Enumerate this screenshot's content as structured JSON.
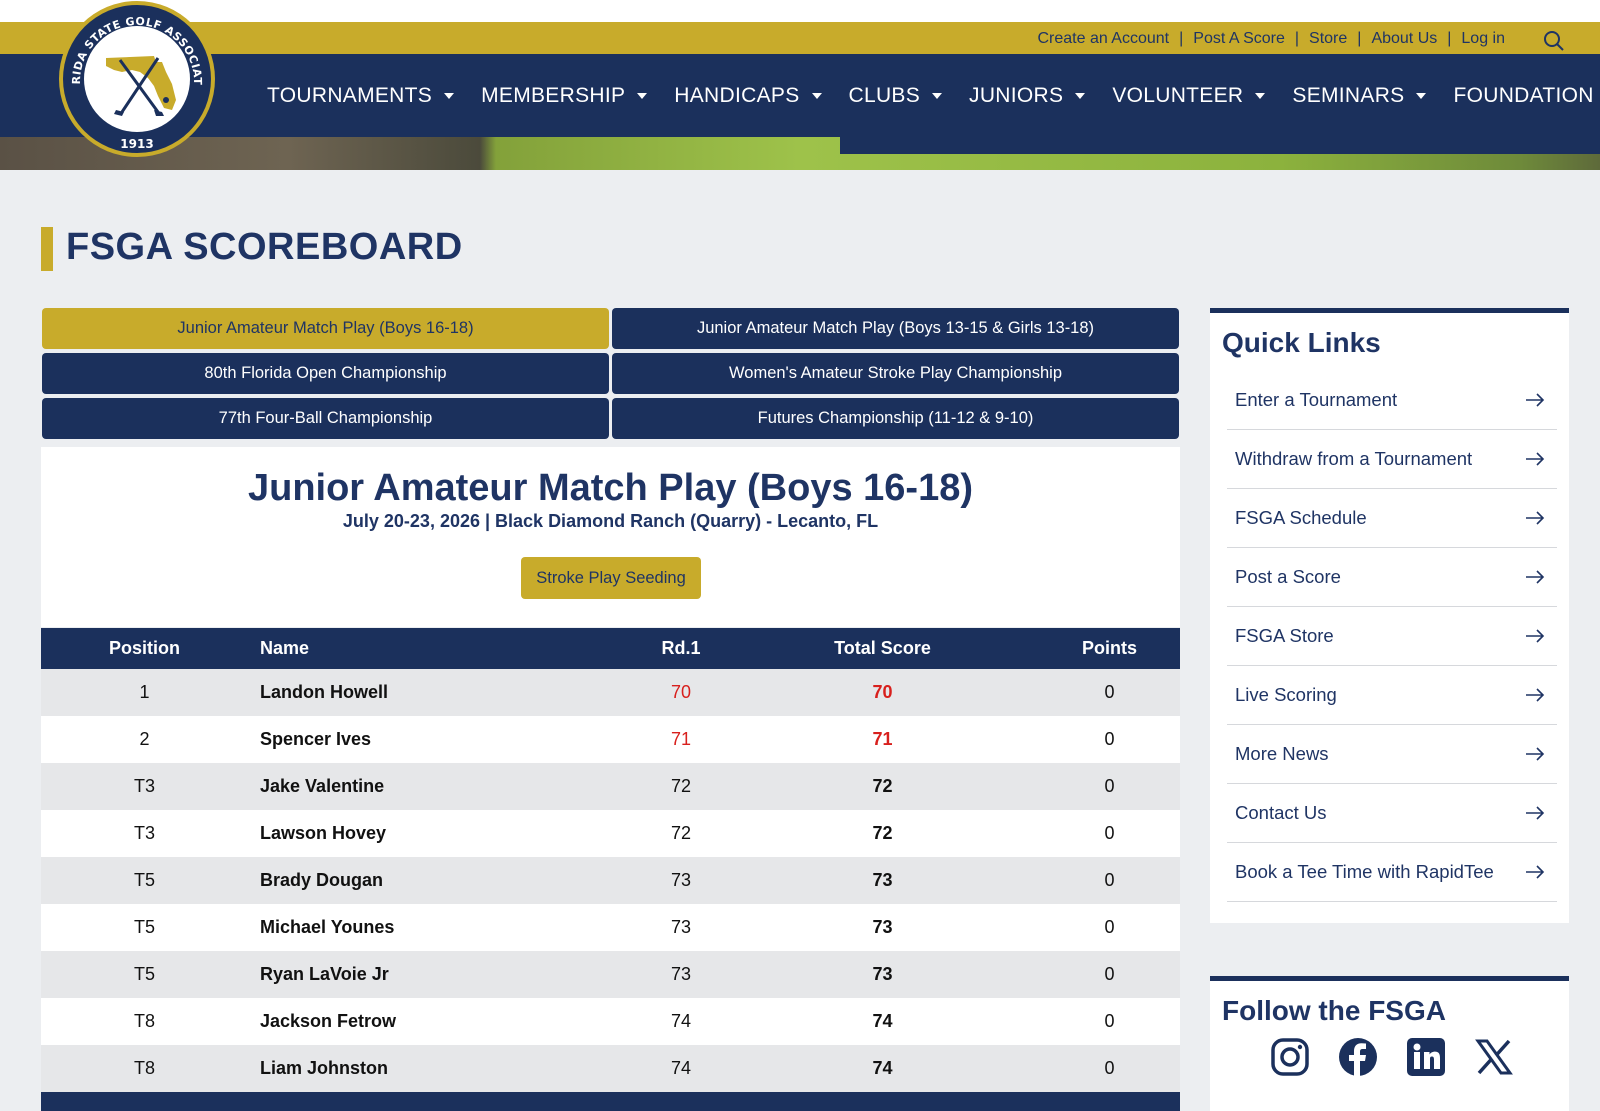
{
  "header": {
    "logo": {
      "name": "FSGA logo",
      "text_top": "FLORIDA STATE GOLF ASSOCIATION",
      "year": "1913"
    },
    "utility_links": [
      "Create an Account",
      "Post A Score",
      "Store",
      "About Us",
      "Log in"
    ],
    "nav_items": [
      "TOURNAMENTS",
      "MEMBERSHIP",
      "HANDICAPS",
      "CLUBS",
      "JUNIORS",
      "VOLUNTEER",
      "SEMINARS",
      "FOUNDATION"
    ]
  },
  "page": {
    "title": "FSGA SCOREBOARD"
  },
  "tabs": [
    {
      "label": "Junior Amateur Match Play (Boys 16-18)",
      "active": true
    },
    {
      "label": "Junior Amateur Match Play (Boys 13-15 & Girls 13-18)",
      "active": false
    },
    {
      "label": "80th Florida Open Championship",
      "active": false
    },
    {
      "label": "Women's Amateur Stroke Play Championship",
      "active": false
    },
    {
      "label": "77th Four-Ball Championship",
      "active": false
    },
    {
      "label": "Futures Championship (11-12 & 9-10)",
      "active": false
    }
  ],
  "event": {
    "title": "Junior Amateur Match Play (Boys 16-18)",
    "subtitle": "July 20-23, 2026 | Black Diamond Ranch (Quarry) - Lecanto, FL",
    "seeding_button": "Stroke Play Seeding"
  },
  "leaderboard": {
    "columns": [
      "Position",
      "Name",
      "Rd.1",
      "Total Score",
      "Points"
    ],
    "rows": [
      {
        "position": "1",
        "name": "Landon Howell",
        "rd1": "70",
        "total": "70",
        "points": "0",
        "under_par": true
      },
      {
        "position": "2",
        "name": "Spencer Ives",
        "rd1": "71",
        "total": "71",
        "points": "0",
        "under_par": true
      },
      {
        "position": "T3",
        "name": "Jake Valentine",
        "rd1": "72",
        "total": "72",
        "points": "0",
        "under_par": false
      },
      {
        "position": "T3",
        "name": "Lawson Hovey",
        "rd1": "72",
        "total": "72",
        "points": "0",
        "under_par": false
      },
      {
        "position": "T5",
        "name": "Brady Dougan",
        "rd1": "73",
        "total": "73",
        "points": "0",
        "under_par": false
      },
      {
        "position": "T5",
        "name": "Michael Younes",
        "rd1": "73",
        "total": "73",
        "points": "0",
        "under_par": false
      },
      {
        "position": "T5",
        "name": "Ryan LaVoie Jr",
        "rd1": "73",
        "total": "73",
        "points": "0",
        "under_par": false
      },
      {
        "position": "T8",
        "name": "Jackson Fetrow",
        "rd1": "74",
        "total": "74",
        "points": "0",
        "under_par": false
      },
      {
        "position": "T8",
        "name": "Liam Johnston",
        "rd1": "74",
        "total": "74",
        "points": "0",
        "under_par": false
      }
    ]
  },
  "sidebar": {
    "quick_links_title": "Quick Links",
    "quick_links": [
      "Enter a Tournament",
      "Withdraw from a Tournament",
      "FSGA Schedule",
      "Post a Score",
      "FSGA Store",
      "Live Scoring",
      "More News",
      "Contact Us",
      "Book a Tee Time with RapidTee"
    ],
    "follow_title": "Follow the FSGA",
    "social_icons": [
      "instagram-icon",
      "facebook-icon",
      "linkedin-icon",
      "x-icon"
    ]
  },
  "colors": {
    "navy": "#1b305c",
    "gold": "#c8ab2b",
    "under_par_red": "#d8201d"
  }
}
